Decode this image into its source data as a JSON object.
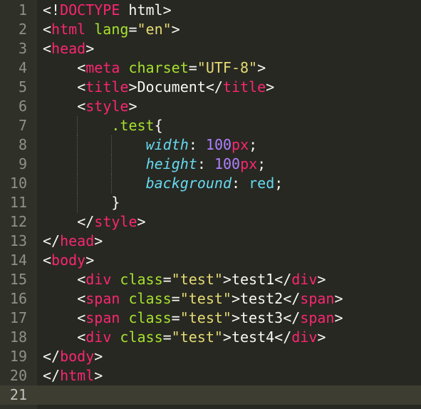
{
  "colors": {
    "background": "#272822",
    "gutter": "#2f3129",
    "current_line": "#3e3d32",
    "line_number": "#8f908a",
    "tag": "#f92672",
    "attribute": "#a6e22e",
    "string": "#e6db74",
    "property": "#66d9ef",
    "number": "#ae81ff",
    "text": "#f8f8f2"
  },
  "editor": {
    "current_line": 21,
    "lines": [
      {
        "n": "1",
        "tokens": [
          [
            "plain",
            "<!"
          ],
          [
            "tag",
            "DOCTYPE"
          ],
          [
            "plain",
            " html>"
          ]
        ]
      },
      {
        "n": "2",
        "tokens": [
          [
            "plain",
            "<"
          ],
          [
            "tag",
            "html"
          ],
          [
            "plain",
            " "
          ],
          [
            "attr",
            "lang"
          ],
          [
            "plain",
            "="
          ],
          [
            "str",
            "\"en\""
          ],
          [
            "plain",
            ">"
          ]
        ]
      },
      {
        "n": "3",
        "tokens": [
          [
            "plain",
            "<"
          ],
          [
            "tag",
            "head"
          ],
          [
            "plain",
            ">"
          ]
        ]
      },
      {
        "n": "4",
        "indent": 1,
        "tokens": [
          [
            "plain",
            "<"
          ],
          [
            "tag",
            "meta"
          ],
          [
            "plain",
            " "
          ],
          [
            "attr",
            "charset"
          ],
          [
            "plain",
            "="
          ],
          [
            "str",
            "\"UTF-8\""
          ],
          [
            "plain",
            ">"
          ]
        ]
      },
      {
        "n": "5",
        "indent": 1,
        "tokens": [
          [
            "plain",
            "<"
          ],
          [
            "tag",
            "title"
          ],
          [
            "plain",
            ">Document</"
          ],
          [
            "tag",
            "title"
          ],
          [
            "plain",
            ">"
          ]
        ]
      },
      {
        "n": "6",
        "indent": 1,
        "tokens": [
          [
            "plain",
            "<"
          ],
          [
            "tag",
            "style"
          ],
          [
            "plain",
            ">"
          ]
        ]
      },
      {
        "n": "7",
        "indent": 2,
        "tokens": [
          [
            "sel",
            ".test"
          ],
          [
            "plain",
            "{"
          ]
        ]
      },
      {
        "n": "8",
        "indent": 3,
        "tokens": [
          [
            "prop",
            "width"
          ],
          [
            "plain",
            ": "
          ],
          [
            "num",
            "100"
          ],
          [
            "unit",
            "px"
          ],
          [
            "plain",
            ";"
          ]
        ]
      },
      {
        "n": "9",
        "indent": 3,
        "tokens": [
          [
            "prop",
            "height"
          ],
          [
            "plain",
            ": "
          ],
          [
            "num",
            "100"
          ],
          [
            "unit",
            "px"
          ],
          [
            "plain",
            ";"
          ]
        ]
      },
      {
        "n": "10",
        "indent": 3,
        "tokens": [
          [
            "prop",
            "background"
          ],
          [
            "plain",
            ": "
          ],
          [
            "val",
            "red"
          ],
          [
            "plain",
            ";"
          ]
        ]
      },
      {
        "n": "11",
        "indent": 2,
        "tokens": [
          [
            "plain",
            "}"
          ]
        ]
      },
      {
        "n": "12",
        "indent": 1,
        "tokens": [
          [
            "plain",
            "</"
          ],
          [
            "tag",
            "style"
          ],
          [
            "plain",
            ">"
          ]
        ]
      },
      {
        "n": "13",
        "tokens": [
          [
            "plain",
            "</"
          ],
          [
            "tag",
            "head"
          ],
          [
            "plain",
            ">"
          ]
        ]
      },
      {
        "n": "14",
        "tokens": [
          [
            "plain",
            "<"
          ],
          [
            "tag",
            "body"
          ],
          [
            "plain",
            ">"
          ]
        ]
      },
      {
        "n": "15",
        "indent": 1,
        "tokens": [
          [
            "plain",
            "<"
          ],
          [
            "tag",
            "div"
          ],
          [
            "plain",
            " "
          ],
          [
            "attr",
            "class"
          ],
          [
            "plain",
            "="
          ],
          [
            "str",
            "\"test\""
          ],
          [
            "plain",
            ">test1</"
          ],
          [
            "tag",
            "div"
          ],
          [
            "plain",
            ">"
          ]
        ]
      },
      {
        "n": "16",
        "indent": 1,
        "tokens": [
          [
            "plain",
            "<"
          ],
          [
            "tag",
            "span"
          ],
          [
            "plain",
            " "
          ],
          [
            "attr",
            "class"
          ],
          [
            "plain",
            "="
          ],
          [
            "str",
            "\"test\""
          ],
          [
            "plain",
            ">test2</"
          ],
          [
            "tag",
            "span"
          ],
          [
            "plain",
            ">"
          ]
        ]
      },
      {
        "n": "17",
        "indent": 1,
        "tokens": [
          [
            "plain",
            "<"
          ],
          [
            "tag",
            "span"
          ],
          [
            "plain",
            " "
          ],
          [
            "attr",
            "class"
          ],
          [
            "plain",
            "="
          ],
          [
            "str",
            "\"test\""
          ],
          [
            "plain",
            ">test3</"
          ],
          [
            "tag",
            "span"
          ],
          [
            "plain",
            ">"
          ]
        ]
      },
      {
        "n": "18",
        "indent": 1,
        "tokens": [
          [
            "plain",
            "<"
          ],
          [
            "tag",
            "div"
          ],
          [
            "plain",
            " "
          ],
          [
            "attr",
            "class"
          ],
          [
            "plain",
            "="
          ],
          [
            "str",
            "\"test\""
          ],
          [
            "plain",
            ">test4</"
          ],
          [
            "tag",
            "div"
          ],
          [
            "plain",
            ">"
          ]
        ]
      },
      {
        "n": "19",
        "tokens": [
          [
            "plain",
            "</"
          ],
          [
            "tag",
            "body"
          ],
          [
            "plain",
            ">"
          ]
        ]
      },
      {
        "n": "20",
        "tokens": [
          [
            "plain",
            "</"
          ],
          [
            "tag",
            "html"
          ],
          [
            "plain",
            ">"
          ]
        ]
      },
      {
        "n": "21",
        "tokens": []
      }
    ]
  }
}
